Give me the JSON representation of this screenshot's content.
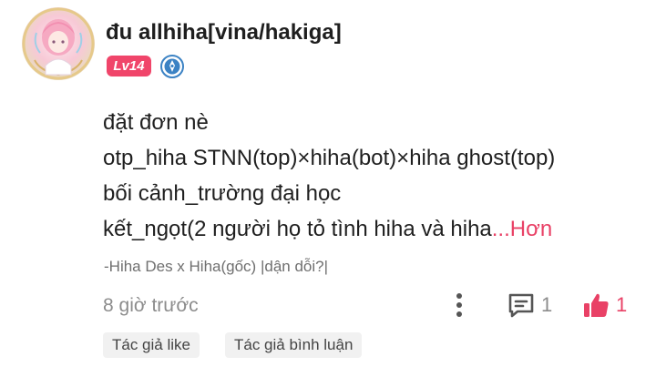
{
  "post": {
    "author": "đu allhiha[vina/hakiga]",
    "level": "Lv14",
    "content_lines": [
      "đặt đơn nè",
      "otp_hiha STNN(top)×hiha(bot)×hiha ghost(top)",
      "bối cảnh_trường đại học",
      "kết_ngọt(2 người họ tỏ tình hiha và hiha"
    ],
    "more_label": "...Hơn",
    "tag_line": "-Hiha Des x Hiha(gốc) |dận dỗi?|",
    "time": "8 giờ trước",
    "comment_count": "1",
    "like_count": "1"
  },
  "chips": {
    "author_liked": "Tác giả like",
    "author_commented": "Tác giả bình luận"
  },
  "colors": {
    "accent": "#e94166",
    "level_badge": "#f0456a",
    "verify_badge": "#3b82c4"
  },
  "icons": [
    "avatar",
    "verified-badge-icon",
    "more-options-icon",
    "comment-icon",
    "thumbs-up-icon"
  ]
}
